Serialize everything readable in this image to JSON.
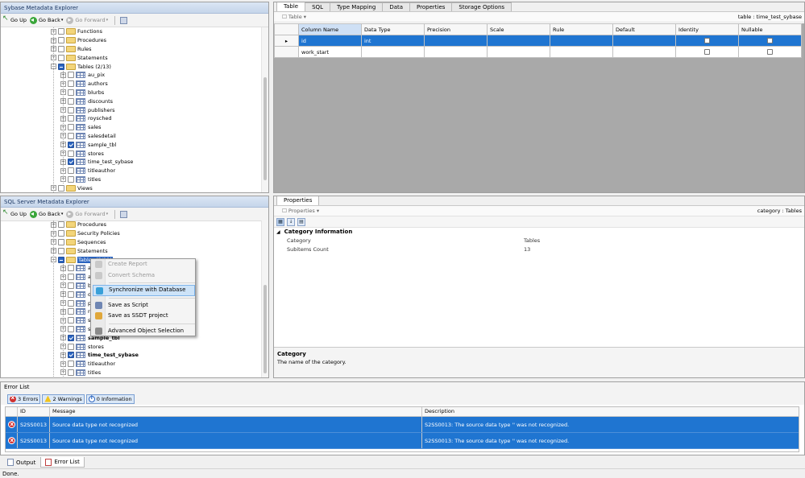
{
  "sybase_explorer": {
    "title": "Sybase Metadata Explorer",
    "toolbar": {
      "go_up": "Go Up",
      "go_back": "Go Back",
      "go_forward": "Go Forward"
    },
    "folders_top": [
      "Functions",
      "Procedures",
      "Rules",
      "Statements"
    ],
    "tables_folder": "Tables (2/13)",
    "tables": [
      {
        "name": "au_pix",
        "checked": false
      },
      {
        "name": "authors",
        "checked": false
      },
      {
        "name": "blurbs",
        "checked": false
      },
      {
        "name": "discounts",
        "checked": false
      },
      {
        "name": "publishers",
        "checked": false
      },
      {
        "name": "roysched",
        "checked": false
      },
      {
        "name": "sales",
        "checked": false
      },
      {
        "name": "salesdetail",
        "checked": false
      },
      {
        "name": "sample_tbl",
        "checked": true
      },
      {
        "name": "stores",
        "checked": false
      },
      {
        "name": "time_test_sybase",
        "checked": true
      },
      {
        "name": "titleauthor",
        "checked": false
      },
      {
        "name": "titles",
        "checked": false
      }
    ],
    "views_folder": "Views"
  },
  "sqlserver_explorer": {
    "title": "SQL Server Metadata Explorer",
    "toolbar": {
      "go_up": "Go Up",
      "go_back": "Go Back",
      "go_forward": "Go Forward"
    },
    "folders_top": [
      "Procedures",
      "Security Policies",
      "Sequences",
      "Statements"
    ],
    "tables_folder": "Tables (2/11)",
    "tables_visible": [
      {
        "name": "au",
        "checked": false,
        "bold": false
      },
      {
        "name": "au",
        "checked": false,
        "bold": false
      },
      {
        "name": "bl",
        "checked": false,
        "bold": false
      },
      {
        "name": "di",
        "checked": false,
        "bold": false
      },
      {
        "name": "pu",
        "checked": false,
        "bold": false
      },
      {
        "name": "ro",
        "checked": false,
        "bold": false
      },
      {
        "name": "sa",
        "checked": false,
        "bold": false
      },
      {
        "name": "sa",
        "checked": false,
        "bold": false
      },
      {
        "name": "sample_tbl",
        "checked": true,
        "bold": true
      },
      {
        "name": "stores",
        "checked": false,
        "bold": false
      },
      {
        "name": "time_test_sybase",
        "checked": true,
        "bold": true
      },
      {
        "name": "titleauthor",
        "checked": false,
        "bold": false
      },
      {
        "name": "titles",
        "checked": false,
        "bold": false
      }
    ]
  },
  "context_menu": {
    "items": [
      {
        "label": "Create Report",
        "disabled": true,
        "icon": "report-icon"
      },
      {
        "label": "Convert Schema",
        "disabled": true,
        "icon": "convert-icon"
      },
      {
        "label": "Synchronize with Database",
        "disabled": false,
        "hover": true,
        "icon": "sync-icon"
      },
      {
        "label": "Save as Script",
        "disabled": false,
        "icon": "script-icon"
      },
      {
        "label": "Save as SSDT project",
        "disabled": false,
        "icon": "ssdt-icon"
      },
      {
        "label": "Advanced Object Selection",
        "disabled": false,
        "icon": "selection-icon"
      }
    ]
  },
  "table_editor": {
    "tabs": [
      "Table",
      "SQL",
      "Type Mapping",
      "Data",
      "Properties",
      "Storage Options"
    ],
    "active_tab": "Table",
    "sub_label": "Table",
    "context": "table : time_test_sybase",
    "columns": [
      "Column Name",
      "Data Type",
      "Precision",
      "Scale",
      "Rule",
      "Default",
      "Identity",
      "Nullable"
    ],
    "rows": [
      {
        "name": "id",
        "type": "int",
        "precision": "",
        "scale": "",
        "rule": "",
        "default": "",
        "selected": true
      },
      {
        "name": "work_start",
        "type": "",
        "precision": "",
        "scale": "",
        "rule": "",
        "default": "",
        "selected": false
      }
    ]
  },
  "properties_pane": {
    "tab": "Properties",
    "sub_label": "Properties",
    "context": "category : Tables",
    "category_header": "Category Information",
    "props": [
      {
        "key": "Category",
        "value": "Tables"
      },
      {
        "key": "Subitems Count",
        "value": "13"
      }
    ],
    "description_title": "Category",
    "description_text": "The name of the category."
  },
  "error_list": {
    "title": "Error List",
    "errors_btn": "3 Errors",
    "warnings_btn": "2 Warnings",
    "info_btn": "0 Information",
    "columns": [
      "ID",
      "Message",
      "Description"
    ],
    "rows": [
      {
        "id": "S2SS0013",
        "message": "Source data type not recognized",
        "description": "S2SS0013: The source data type '' was not recognized."
      },
      {
        "id": "S2SS0013",
        "message": "Source data type not recognized",
        "description": "S2SS0013: The source data type '' was not recognized."
      }
    ]
  },
  "bottom_tabs": [
    "Output",
    "Error List"
  ],
  "status": "Done."
}
